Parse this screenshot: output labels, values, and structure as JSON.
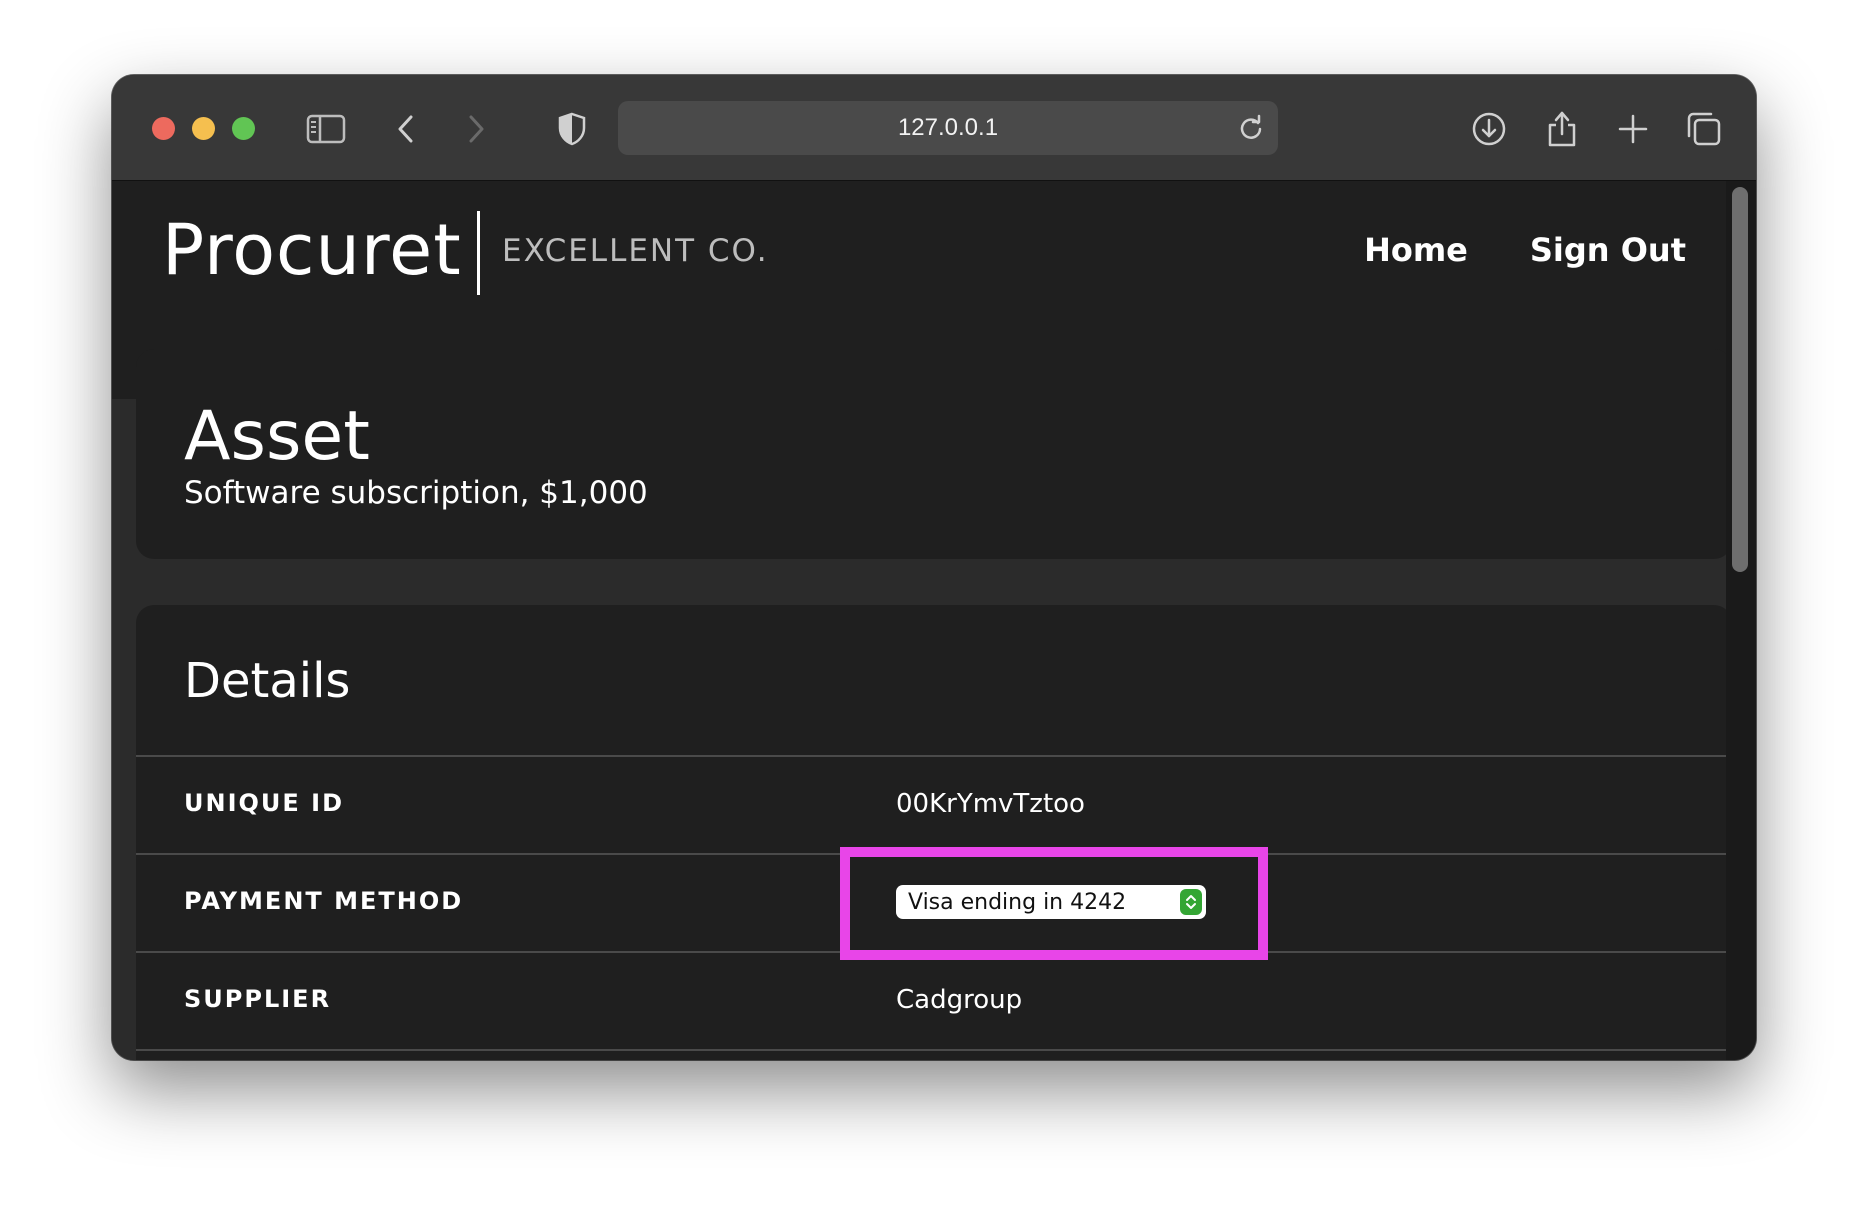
{
  "browser": {
    "url": "127.0.0.1",
    "traffic_colors": [
      "#ed6a5e",
      "#f5bf4f",
      "#61c554"
    ]
  },
  "nav": {
    "brand": "Procuret",
    "company": "EXCELLENT CO.",
    "links": [
      "Home",
      "Sign Out"
    ]
  },
  "asset": {
    "title": "Asset",
    "subtitle": "Software subscription, $1,000"
  },
  "details": {
    "title": "Details",
    "rows": [
      {
        "label": "UNIQUE ID",
        "value": "00KrYmvTztoo"
      },
      {
        "label": "PAYMENT METHOD",
        "value": "Visa ending in 4242"
      },
      {
        "label": "SUPPLIER",
        "value": "Cadgroup"
      }
    ]
  },
  "colors": {
    "highlight": "#e845e8",
    "select_arrow": "#34a634"
  }
}
